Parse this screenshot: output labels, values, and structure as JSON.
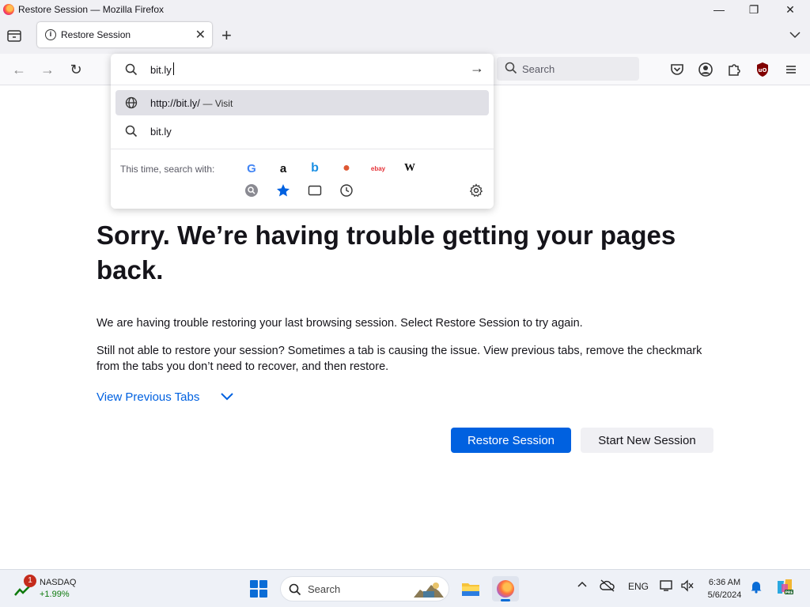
{
  "window": {
    "title": "Restore Session — Mozilla Firefox",
    "minimize": "—",
    "restore": "❐",
    "close": "✕"
  },
  "tab": {
    "label": "Restore Session",
    "close": "✕",
    "new_tab": "+",
    "all_tabs": "⌄"
  },
  "navbar": {
    "back": "←",
    "forward": "→",
    "reload": "↻",
    "search_placeholder": "Search"
  },
  "urlbar": {
    "value": "bit.ly",
    "go": "→",
    "results": [
      {
        "text": "http://bit.ly/",
        "action": "— Visit",
        "icon": "globe-icon"
      },
      {
        "text": "bit.ly",
        "action": "",
        "icon": "search-icon"
      }
    ],
    "oneoff_label": "This time, search with:",
    "engines": [
      {
        "name": "google-icon",
        "glyph": "G",
        "color": "#4285f4"
      },
      {
        "name": "amazon-icon",
        "glyph": "a",
        "color": "#111111"
      },
      {
        "name": "bing-icon",
        "glyph": "b",
        "color": "#1a8fe3"
      },
      {
        "name": "duckduckgo-icon",
        "glyph": "●",
        "color": "#de5833"
      },
      {
        "name": "ebay-icon",
        "glyph": "ebay",
        "color": "#e53238"
      },
      {
        "name": "wikipedia-icon",
        "glyph": "W",
        "color": "#111111"
      }
    ]
  },
  "page": {
    "title": "Sorry. We’re having trouble getting your pages back.",
    "p1": "We are having trouble restoring your last browsing session. Select Restore Session to try again.",
    "p2": "Still not able to restore your session? Sometimes a tab is causing the issue. View previous tabs, remove the checkmark from the tabs you don’t need to recover, and then restore.",
    "view_tabs": "View Previous Tabs",
    "restore_button": "Restore Session",
    "new_session_button": "Start New Session"
  },
  "taskbar": {
    "widget_badge": "1",
    "widget_title": "NASDAQ",
    "widget_value": "+1.99%",
    "search_placeholder": "Search",
    "lang": "ENG",
    "time": "6:36 AM",
    "date": "5/6/2024"
  },
  "colors": {
    "accent": "#0061e0",
    "positive": "#0e7a0d"
  }
}
